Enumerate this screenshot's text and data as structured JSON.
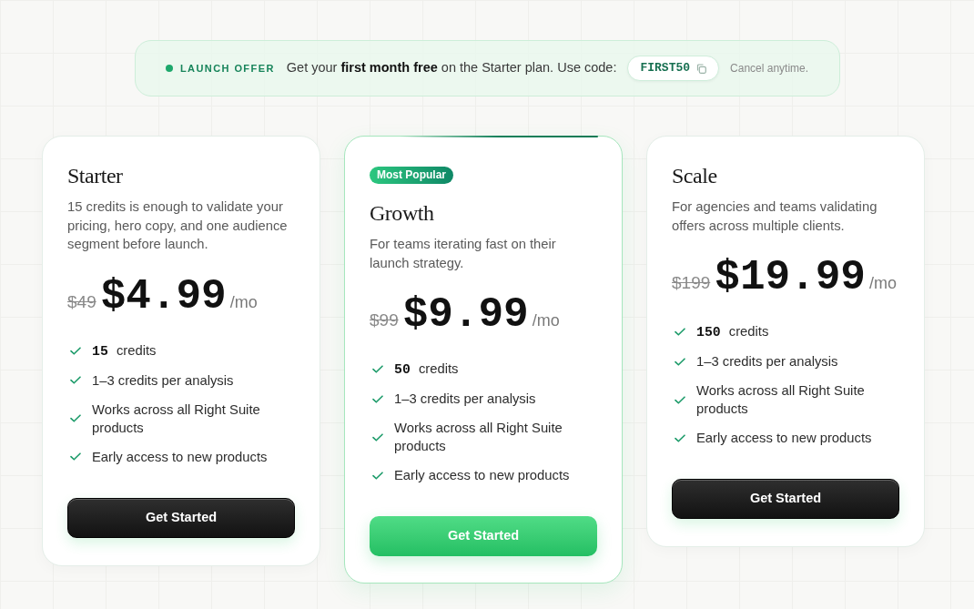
{
  "banner": {
    "label": "LAUNCH OFFER",
    "message": "Get your **first month free** on the Starter plan. Use code:",
    "code": "FIRST50",
    "note": "Cancel anytime."
  },
  "plans": [
    {
      "name": "Starter",
      "featured": false,
      "description": "15 credits is enough to validate your pricing, hero copy, and one audience segment before launch.",
      "original_price": "$49",
      "price": "$4.99",
      "period": "/mo",
      "features": [
        "**15** credits",
        "1–3 credits per analysis",
        "Works across all Right Suite products",
        "Early access to new products"
      ],
      "button": "Get Started"
    },
    {
      "name": "Growth",
      "featured": true,
      "badge": "Most Popular",
      "description": "For teams iterating fast on their launch strategy.",
      "original_price": "$99",
      "price": "$9.99",
      "period": "/mo",
      "features": [
        "**50** credits",
        "1–3 credits per analysis",
        "Works across all Right Suite products",
        "Early access to new products"
      ],
      "button": "Get Started"
    },
    {
      "name": "Scale",
      "featured": false,
      "description": "For agencies and teams validating offers across multiple clients.",
      "original_price": "$199",
      "price": "$19.99",
      "period": "/mo",
      "features": [
        "**150** credits",
        "1–3 credits per analysis",
        "Works across all Right Suite products",
        "Early access to new products"
      ],
      "button": "Get Started"
    }
  ]
}
